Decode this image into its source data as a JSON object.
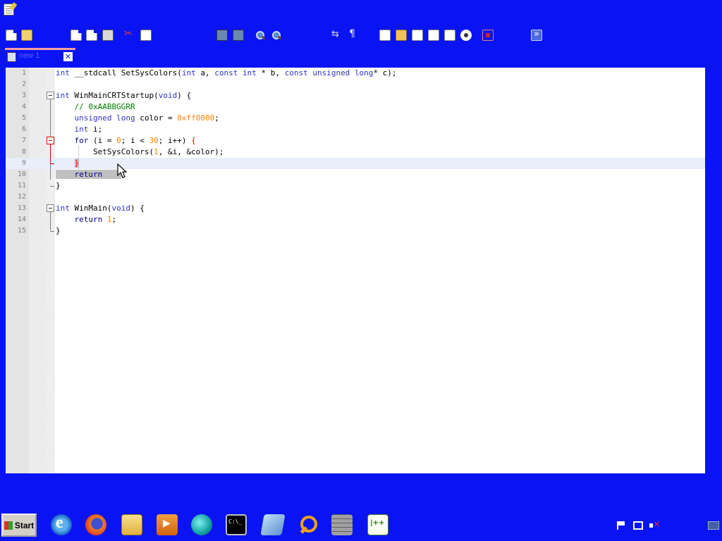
{
  "window": {
    "app_icon": "notepad-icon",
    "tab_label": "new 1",
    "tab_close": "✕"
  },
  "toolbar": {
    "buttons": [
      {
        "name": "new-file-button",
        "icon": "new-file-icon"
      },
      {
        "name": "open-file-button",
        "icon": "folder-open-icon"
      },
      {
        "name": "save-button",
        "icon": "save-icon"
      },
      {
        "name": "close-button",
        "icon": "close-icon"
      },
      {
        "name": "print-button",
        "icon": "print-icon"
      },
      {
        "name": "cut-button",
        "icon": "cut-icon"
      },
      {
        "name": "copy-button",
        "icon": "copy-icon"
      },
      {
        "name": "find-button",
        "icon": "find-icon"
      },
      {
        "name": "replace-button",
        "icon": "replace-icon"
      },
      {
        "name": "zoom-in-button",
        "icon": "zoom-in-icon"
      },
      {
        "name": "zoom-out-button",
        "icon": "zoom-out-icon"
      },
      {
        "name": "word-wrap-button",
        "icon": "word-wrap-icon"
      },
      {
        "name": "show-all-chars-button",
        "icon": "pilcrow-icon"
      },
      {
        "name": "macro-record-button",
        "icon": "record-icon"
      },
      {
        "name": "run-macro-button",
        "icon": "fast-forward-icon"
      }
    ]
  },
  "editor": {
    "current_line": 9,
    "lines": [
      {
        "n": "1",
        "text": "int __stdcall SetSysColors(int a, const int * b, const unsigned long* c);"
      },
      {
        "n": "2",
        "text": ""
      },
      {
        "n": "3",
        "text": "int WinMainCRTStartup(void) {"
      },
      {
        "n": "4",
        "text": "    // 0xAABBGGRR"
      },
      {
        "n": "5",
        "text": "    unsigned long color = 0xff0000;"
      },
      {
        "n": "6",
        "text": "    int i;"
      },
      {
        "n": "7",
        "text": "    for (i = 0; i < 30; i++) {"
      },
      {
        "n": "8",
        "text": "        SetSysColors(1, &i, &color);"
      },
      {
        "n": "9",
        "text": "    }"
      },
      {
        "n": "10",
        "text": "    return"
      },
      {
        "n": "11",
        "text": "}"
      },
      {
        "n": "12",
        "text": ""
      },
      {
        "n": "13",
        "text": "int WinMain(void) {"
      },
      {
        "n": "14",
        "text": "    return 1;"
      },
      {
        "n": "15",
        "text": "}"
      }
    ]
  },
  "taskbar": {
    "start_label": "Start",
    "apps": [
      "internet-explorer-icon",
      "firefox-icon",
      "file-explorer-icon",
      "media-player-icon",
      "browser-globe-icon",
      "command-prompt-icon",
      "notebook-icon",
      "search-icon",
      "firewall-icon",
      "notepad-plus-plus-icon"
    ],
    "tray": [
      "action-center-flag-icon",
      "network-icon",
      "volume-muted-icon",
      "show-desktop-icon"
    ]
  },
  "colors": {
    "desktop": "#0a14f2",
    "keyword": "#3030c8",
    "type": "#8000ff",
    "number": "#ff8000",
    "comment": "#008000",
    "brace_match": "#ff0000"
  }
}
